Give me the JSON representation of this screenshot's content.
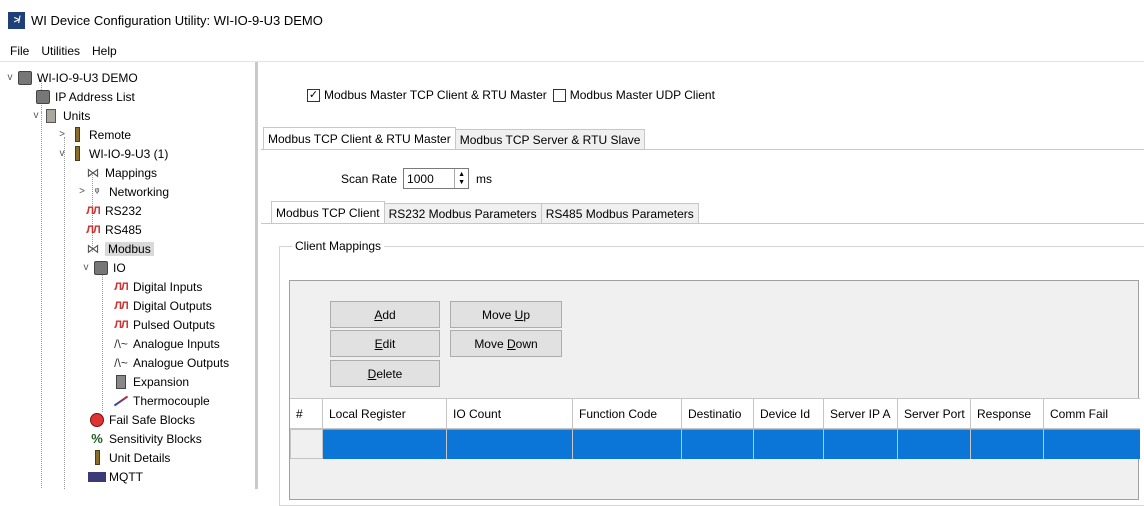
{
  "window": {
    "title": "WI Device Configuration Utility: WI-IO-9-U3 DEMO",
    "icon": "app-logo-icon"
  },
  "menu": [
    "File",
    "Utilities",
    "Help"
  ],
  "tree": {
    "root": "WI-IO-9-U3 DEMO",
    "ip_address_list": "IP Address List",
    "units": "Units",
    "remote": "Remote",
    "unit": "WI-IO-9-U3 (1)",
    "mappings": "Mappings",
    "networking": "Networking",
    "rs232": "RS232",
    "rs485": "RS485",
    "modbus": "Modbus",
    "io": "IO",
    "digital_inputs": "Digital Inputs",
    "digital_outputs": "Digital Outputs",
    "pulsed_outputs": "Pulsed Outputs",
    "analogue_inputs": "Analogue Inputs",
    "analogue_outputs": "Analogue Outputs",
    "expansion": "Expansion",
    "thermocouple": "Thermocouple",
    "fail_safe_blocks": "Fail Safe Blocks",
    "sensitivity_blocks": "Sensitivity Blocks",
    "unit_details": "Unit Details",
    "mqtt": "MQTT",
    "selected": "Modbus"
  },
  "main": {
    "checkbox_tcp_rtu": {
      "label": "Modbus Master TCP Client & RTU Master",
      "checked": true
    },
    "checkbox_udp": {
      "label": "Modbus Master UDP Client",
      "checked": false
    },
    "tabs": [
      "Modbus TCP Client & RTU Master",
      "Modbus TCP Server & RTU Slave"
    ],
    "active_tab": "Modbus TCP Client & RTU Master",
    "scan_rate": {
      "label": "Scan Rate",
      "value": "1000",
      "unit": "ms"
    },
    "sub_tabs": [
      "Modbus TCP Client",
      "RS232 Modbus Parameters",
      "RS485 Modbus Parameters"
    ],
    "active_sub_tab": "Modbus TCP Client",
    "group_label": "Client Mappings",
    "buttons": {
      "add": {
        "underline": "A",
        "rest": "dd"
      },
      "edit": {
        "underline": "E",
        "rest": "dit"
      },
      "delete": {
        "underline": "D",
        "rest": "elete"
      },
      "move_up": {
        "pre": "Move ",
        "underline": "U",
        "rest": "p"
      },
      "move_down": {
        "pre": "Move ",
        "underline": "D",
        "rest": "own"
      }
    },
    "grid_columns": [
      "#",
      "Local Register",
      "IO Count",
      "Function Code",
      "Destinatio",
      "Device Id",
      "Server IP A",
      "Server Port",
      "Response ",
      "Comm Fail"
    ],
    "selection_color": "#0b76d8"
  }
}
